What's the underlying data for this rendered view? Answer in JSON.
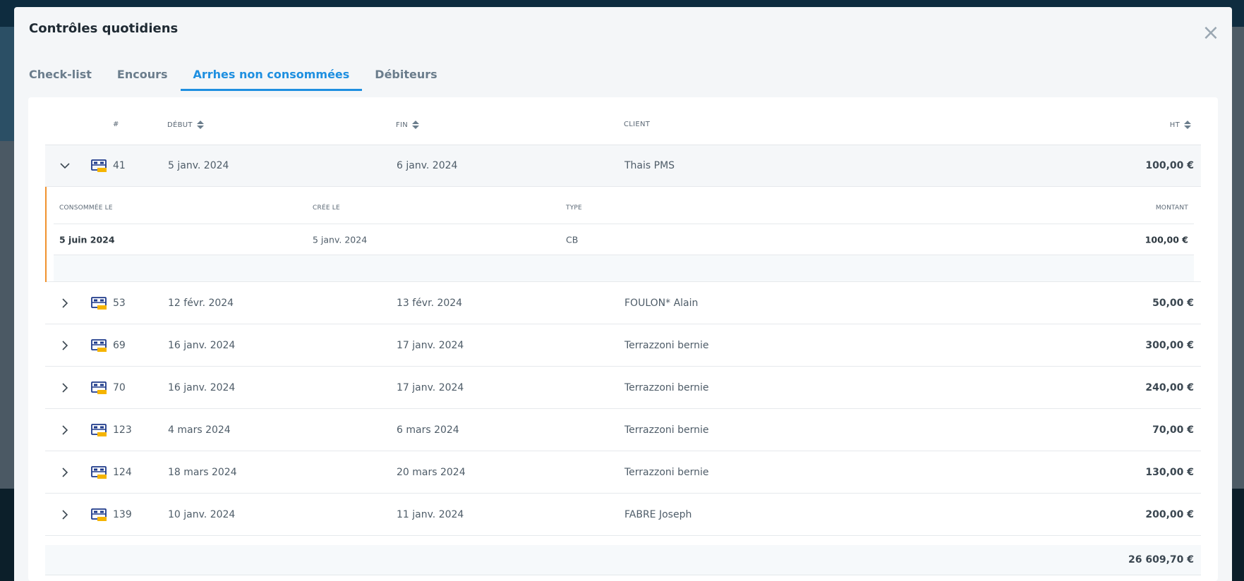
{
  "modal": {
    "title": "Contrôles quotidiens",
    "close_label": "×"
  },
  "tabs": [
    {
      "label": "Check-list",
      "active": false
    },
    {
      "label": "Encours",
      "active": false
    },
    {
      "label": "Arrhes non consommées",
      "active": true
    },
    {
      "label": "Débiteurs",
      "active": false
    }
  ],
  "table": {
    "columns": {
      "num": "#",
      "debut": "DÉBUT",
      "fin": "FIN",
      "client": "CLIENT",
      "ht": "HT"
    },
    "rows": [
      {
        "num": "41",
        "debut": "5 janv. 2024",
        "fin": "6 janv. 2024",
        "client": "Thais PMS",
        "ht": "100,00 €",
        "expanded": true
      },
      {
        "num": "53",
        "debut": "12 févr. 2024",
        "fin": "13 févr. 2024",
        "client": "FOULON* Alain",
        "ht": "50,00 €"
      },
      {
        "num": "69",
        "debut": "16 janv. 2024",
        "fin": "17 janv. 2024",
        "client": "Terrazzoni bernie",
        "ht": "300,00 €"
      },
      {
        "num": "70",
        "debut": "16 janv. 2024",
        "fin": "17 janv. 2024",
        "client": "Terrazzoni bernie",
        "ht": "240,00 €"
      },
      {
        "num": "123",
        "debut": "4 mars 2024",
        "fin": "6 mars 2024",
        "client": "Terrazzoni bernie",
        "ht": "70,00 €"
      },
      {
        "num": "124",
        "debut": "18 mars 2024",
        "fin": "20 mars 2024",
        "client": "Terrazzoni bernie",
        "ht": "130,00 €"
      },
      {
        "num": "139",
        "debut": "10 janv. 2024",
        "fin": "11 janv. 2024",
        "client": "FABRE Joseph",
        "ht": "200,00 €"
      }
    ],
    "detail": {
      "columns": {
        "consommee": "CONSOMMÉE LE",
        "cree": "CRÉE LE",
        "type": "TYPE",
        "montant": "MONTANT"
      },
      "row": {
        "consommee": "5 juin 2024",
        "cree": "5 janv. 2024",
        "type": "CB",
        "montant": "100,00 €"
      }
    },
    "total": "26 609,70 €"
  },
  "colors": {
    "accent": "#1e8fe0",
    "detail_bar": "#f0922e",
    "bed_icon": "#1e3a8a",
    "bed_icon_badge": "#f5b400"
  },
  "icons": {
    "expand": "chevron-right-icon",
    "collapse": "chevron-down-icon",
    "room": "bed-icon",
    "sort": "sort-icon",
    "close": "close-icon"
  }
}
